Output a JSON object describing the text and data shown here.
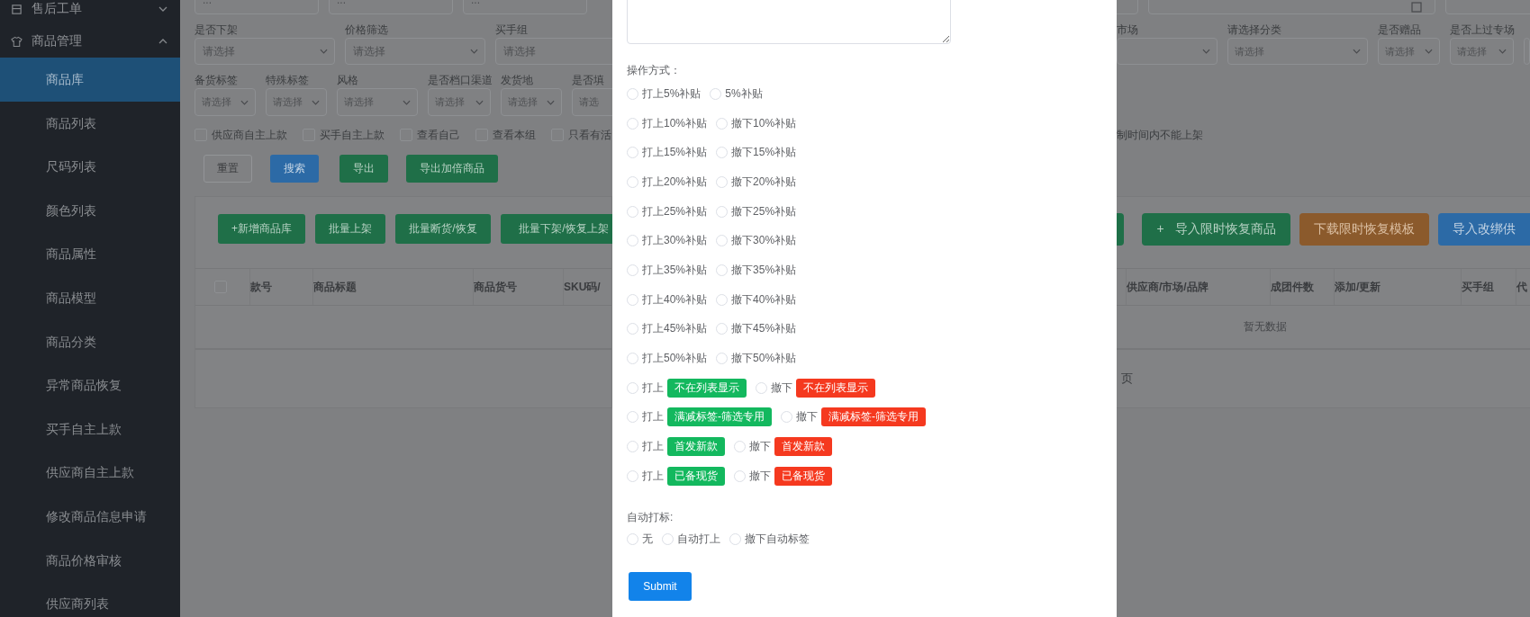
{
  "sidebar": {
    "items": [
      {
        "label": "售后工单",
        "expanded": false
      },
      {
        "label": "商品管理",
        "expanded": true,
        "children": [
          {
            "label": "商品库",
            "selected": true
          },
          {
            "label": "商品列表",
            "selected": false
          },
          {
            "label": "尺码列表",
            "selected": false
          },
          {
            "label": "颜色列表",
            "selected": false
          },
          {
            "label": "商品属性",
            "selected": false
          },
          {
            "label": "商品模型",
            "selected": false
          },
          {
            "label": "商品分类",
            "selected": false
          },
          {
            "label": "异常商品恢复",
            "selected": false
          },
          {
            "label": "买手自主上款",
            "selected": false
          },
          {
            "label": "供应商自主上款",
            "selected": false
          },
          {
            "label": "修改商品信息申请",
            "selected": false
          },
          {
            "label": "商品价格审核",
            "selected": false
          },
          {
            "label": "供应商列表",
            "selected": false
          }
        ]
      }
    ]
  },
  "left_panel": {
    "top_fields": [
      {
        "placeholder": "..."
      },
      {
        "placeholder": "..."
      },
      {
        "placeholder": "..."
      }
    ],
    "filter_row_1": [
      {
        "label": "是否下架",
        "kind": "select",
        "placeholder": "请选择"
      },
      {
        "label": "价格筛选",
        "kind": "select",
        "placeholder": "请选择"
      },
      {
        "label": "买手组",
        "kind": "input",
        "placeholder": "请选择"
      }
    ],
    "filter_row_2": [
      {
        "label": "备货标签",
        "kind": "select",
        "placeholder": "请选择"
      },
      {
        "label": "特殊标签",
        "kind": "select",
        "placeholder": "请选择"
      },
      {
        "label": "风格",
        "kind": "select",
        "placeholder": "请选择"
      },
      {
        "label": "是否档口渠道",
        "kind": "select",
        "placeholder": "请选择"
      },
      {
        "label": "发货地",
        "kind": "select",
        "placeholder": "请选择"
      },
      {
        "label": "是否填",
        "kind": "input",
        "placeholder": "请选"
      }
    ],
    "checkboxes": [
      {
        "label": "供应商自主上款",
        "checked": false
      },
      {
        "label": "买手自主上款",
        "checked": false
      },
      {
        "label": "查看自己",
        "checked": false
      },
      {
        "label": "查看本组",
        "checked": false
      },
      {
        "label": "只看有活",
        "checked": false
      }
    ],
    "buttons": [
      {
        "label": "重置",
        "kind": "plain"
      },
      {
        "label": "搜索",
        "kind": "primary"
      },
      {
        "label": "导出",
        "kind": "success"
      },
      {
        "label": "导出加倍商品",
        "kind": "success"
      }
    ],
    "actions": [
      {
        "label": "+新增商品库",
        "kind": "success"
      },
      {
        "label": "批量上架",
        "kind": "success"
      },
      {
        "label": "批量断货/恢复",
        "kind": "success"
      },
      {
        "label": "批量下架/恢复上架",
        "kind": "success"
      }
    ],
    "table": {
      "select_all": {
        "checked": false
      },
      "columns": [
        "款号",
        "商品标题",
        "商品货号",
        "SKU码/"
      ]
    }
  },
  "right_panel": {
    "top_fields": [
      {
        "kind": "input"
      },
      {
        "kind": "date"
      },
      {
        "kind": "input"
      }
    ],
    "filter_row_1": [
      {
        "label": "市场",
        "kind": "select"
      },
      {
        "label": "请选择分类",
        "kind": "select",
        "placeholder": "请选择"
      },
      {
        "label": "是否赠品",
        "kind": "select",
        "placeholder": "请选择"
      },
      {
        "label": "是否上过专场",
        "kind": "select",
        "placeholder": "请选择"
      },
      {
        "kind": "input"
      }
    ],
    "note": "制时间内不能上架",
    "actions": [
      {
        "kind": "success"
      },
      {
        "prefix": "+",
        "label": "导入限时恢复商品",
        "kind": "success"
      },
      {
        "label": "下载限时恢复模板",
        "kind": "warning"
      },
      {
        "label": "导入改绑供",
        "kind": "primary"
      }
    ],
    "table": {
      "columns": [
        "",
        "供应商/市场/品牌",
        "成团件数",
        "添加/更新",
        "买手组",
        "代"
      ],
      "empty_text": "暂无数据"
    },
    "pagination_text": "页"
  },
  "dialog": {
    "operation_label": "操作方式：",
    "operations": [
      {
        "options": [
          {
            "label": "打上5%补贴",
            "selected": false
          },
          {
            "label": "5%补贴",
            "selected": false
          }
        ]
      },
      {
        "options": [
          {
            "label": "打上10%补贴",
            "selected": false
          },
          {
            "label": "撤下10%补贴",
            "selected": false
          }
        ]
      },
      {
        "options": [
          {
            "label": "打上15%补贴",
            "selected": false
          },
          {
            "label": "撤下15%补贴",
            "selected": false
          }
        ]
      },
      {
        "options": [
          {
            "label": "打上20%补贴",
            "selected": false
          },
          {
            "label": "撤下20%补贴",
            "selected": false
          }
        ]
      },
      {
        "options": [
          {
            "label": "打上25%补贴",
            "selected": false
          },
          {
            "label": "撤下25%补贴",
            "selected": false
          }
        ]
      },
      {
        "options": [
          {
            "label": "打上30%补贴",
            "selected": false
          },
          {
            "label": "撤下30%补贴",
            "selected": false
          }
        ]
      },
      {
        "options": [
          {
            "label": "打上35%补贴",
            "selected": false
          },
          {
            "label": "撤下35%补贴",
            "selected": false
          }
        ]
      },
      {
        "options": [
          {
            "label": "打上40%补贴",
            "selected": false
          },
          {
            "label": "撤下40%补贴",
            "selected": false
          }
        ]
      },
      {
        "options": [
          {
            "label": "打上45%补贴",
            "selected": false
          },
          {
            "label": "撤下45%补贴",
            "selected": false
          }
        ]
      },
      {
        "options": [
          {
            "label": "打上50%补贴",
            "selected": false
          },
          {
            "label": "撤下50%补贴",
            "selected": false
          }
        ]
      },
      {
        "options": [
          {
            "label": "打上",
            "tag": "不在列表显示",
            "color": "#13b85e",
            "selected": false
          },
          {
            "label": "撤下",
            "tag": "不在列表显示",
            "color": "#f5391f",
            "selected": false
          }
        ]
      },
      {
        "options": [
          {
            "label": "打上",
            "tag": "满减标签-筛选专用",
            "color": "#13b85e",
            "selected": false
          },
          {
            "label": "撤下",
            "tag": "满减标签-筛选专用",
            "color": "#f5391f",
            "selected": false
          }
        ]
      },
      {
        "options": [
          {
            "label": "打上",
            "tag": "首发新款",
            "color": "#13b85e",
            "selected": false
          },
          {
            "label": "撤下",
            "tag": "首发新款",
            "color": "#f5391f",
            "selected": false
          }
        ]
      },
      {
        "options": [
          {
            "label": "打上",
            "tag": "已备现货",
            "color": "#13b85e",
            "selected": false
          },
          {
            "label": "撤下",
            "tag": "已备现货",
            "color": "#f5391f",
            "selected": false
          }
        ]
      }
    ],
    "auto_label": "自动打标:",
    "auto_options": [
      {
        "label": "无",
        "selected": false
      },
      {
        "label": "自动打上",
        "selected": false
      },
      {
        "label": "撤下自动标签",
        "selected": false
      }
    ],
    "submit": "Submit"
  }
}
